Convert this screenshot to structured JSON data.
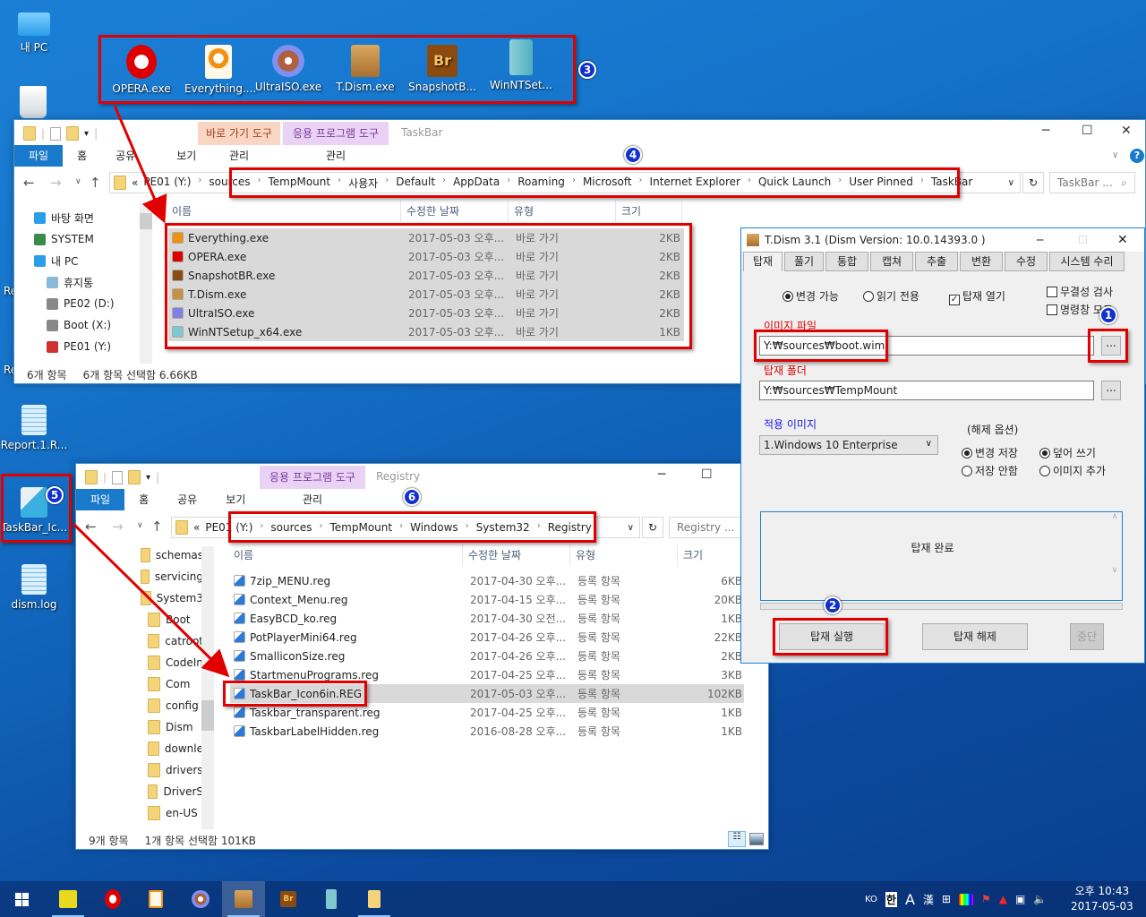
{
  "desktop": {
    "icons": [
      {
        "label": "내 PC"
      },
      {
        "label": "Report.1.R..."
      },
      {
        "label": "TaskBar_Ic..."
      },
      {
        "label": "dism.log"
      }
    ],
    "partial_labels": [
      "Re",
      "Re"
    ]
  },
  "pinned_group": {
    "items": [
      {
        "label": "OPERA.exe"
      },
      {
        "label": "Everything...."
      },
      {
        "label": "UltraISO.exe"
      },
      {
        "label": "T.Dism.exe"
      },
      {
        "label": "SnapshotB..."
      },
      {
        "label": "WinNTSet..."
      }
    ]
  },
  "badges": [
    "1",
    "2",
    "3",
    "4",
    "5",
    "6"
  ],
  "explorer_top": {
    "title": "TaskBar",
    "ctx_tools": [
      {
        "top": "바로 가기 도구",
        "bottom": "관리",
        "color": "#f8d6c3"
      },
      {
        "top": "응용 프로그램 도구",
        "bottom": "관리",
        "color": "#e9d2f4"
      }
    ],
    "ribbon_tabs": [
      "파일",
      "홈",
      "공유",
      "보기"
    ],
    "address_prefix": "«",
    "address": [
      "PE01 (Y:)",
      "sources",
      "TempMount",
      "사용자",
      "Default",
      "AppData",
      "Roaming",
      "Microsoft",
      "Internet Explorer",
      "Quick Launch",
      "User Pinned",
      "TaskBar"
    ],
    "search_placeholder": "TaskBar ...",
    "tree": [
      {
        "label": "바탕 화면"
      },
      {
        "label": "SYSTEM"
      },
      {
        "label": "내 PC"
      },
      {
        "label": "휴지통"
      },
      {
        "label": "PE02 (D:)"
      },
      {
        "label": "Boot (X:)"
      },
      {
        "label": "PE01 (Y:)"
      }
    ],
    "columns": [
      "이름",
      "수정한 날짜",
      "유형",
      "크기"
    ],
    "rows": [
      {
        "name": "Everything.exe",
        "date": "2017-05-03 오후...",
        "type": "바로 가기",
        "size": "2KB"
      },
      {
        "name": "OPERA.exe",
        "date": "2017-05-03 오후...",
        "type": "바로 가기",
        "size": "2KB"
      },
      {
        "name": "SnapshotBR.exe",
        "date": "2017-05-03 오후...",
        "type": "바로 가기",
        "size": "2KB"
      },
      {
        "name": "T.Dism.exe",
        "date": "2017-05-03 오후...",
        "type": "바로 가기",
        "size": "2KB"
      },
      {
        "name": "UltraISO.exe",
        "date": "2017-05-03 오후...",
        "type": "바로 가기",
        "size": "2KB"
      },
      {
        "name": "WinNTSetup_x64.exe",
        "date": "2017-05-03 오후...",
        "type": "바로 가기",
        "size": "1KB"
      }
    ],
    "status_count": "6개 항목",
    "status_selected": "6개 항목 선택함 6.66KB"
  },
  "explorer_bottom": {
    "title": "Registry",
    "ctx_tools": [
      {
        "top": "응용 프로그램 도구",
        "bottom": "관리",
        "color": "#e9d2f4"
      }
    ],
    "ribbon_tabs": [
      "파일",
      "홈",
      "공유",
      "보기"
    ],
    "address_prefix": "«",
    "address": [
      "PE01 (Y:)",
      "sources",
      "TempMount",
      "Windows",
      "System32",
      "Registry"
    ],
    "search_placeholder": "Registry ...",
    "tree": [
      {
        "label": "schemas"
      },
      {
        "label": "servicing"
      },
      {
        "label": "System3"
      },
      {
        "label": "Boot"
      },
      {
        "label": "catroot"
      },
      {
        "label": "CodeIn"
      },
      {
        "label": "Com"
      },
      {
        "label": "config"
      },
      {
        "label": "Dism"
      },
      {
        "label": "downle"
      },
      {
        "label": "drivers"
      },
      {
        "label": "DriverS"
      },
      {
        "label": "en-US"
      }
    ],
    "columns": [
      "이름",
      "수정한 날짜",
      "유형",
      "크기"
    ],
    "rows": [
      {
        "name": "7zip_MENU.reg",
        "date": "2017-04-30 오후...",
        "type": "등록 항목",
        "size": "6KB"
      },
      {
        "name": "Context_Menu.reg",
        "date": "2017-04-15 오후...",
        "type": "등록 항목",
        "size": "20KB"
      },
      {
        "name": "EasyBCD_ko.reg",
        "date": "2017-04-30 오전...",
        "type": "등록 항목",
        "size": "1KB"
      },
      {
        "name": "PotPlayerMini64.reg",
        "date": "2017-04-26 오후...",
        "type": "등록 항목",
        "size": "22KB"
      },
      {
        "name": "SmalliconSize.reg",
        "date": "2017-04-26 오후...",
        "type": "등록 항목",
        "size": "2KB"
      },
      {
        "name": "StartmenuPrograms.reg",
        "date": "2017-04-25 오후...",
        "type": "등록 항목",
        "size": "3KB"
      },
      {
        "name": "TaskBar_Icon6in.REG",
        "date": "2017-05-03 오후...",
        "type": "등록 항목",
        "size": "102KB",
        "selected": true
      },
      {
        "name": "Taskbar_transparent.reg",
        "date": "2017-04-25 오후...",
        "type": "등록 항목",
        "size": "1KB"
      },
      {
        "name": "TaskbarLabelHidden.reg",
        "date": "2016-08-28 오후...",
        "type": "등록 항목",
        "size": "1KB"
      }
    ],
    "status_count": "9개 항목",
    "status_selected": "1개 항목 선택함 101KB"
  },
  "tdism": {
    "title": "T.Dism 3.1 (Dism Version: 10.0.14393.0 )",
    "tabs": [
      "탑재",
      "풀기",
      "통합",
      "캡쳐",
      "추출",
      "변환",
      "수정",
      "시스템 수리"
    ],
    "mode_options": [
      {
        "label": "변경 가능",
        "checked": true
      },
      {
        "label": "읽기 전용",
        "checked": false
      }
    ],
    "open_mount": {
      "label": "탑재 열기",
      "checked": true
    },
    "integrity_check": {
      "label": "무결성 검사",
      "checked": false
    },
    "cmd_mode": {
      "label": "명령창 모드",
      "checked": false
    },
    "image_file_label": "이미지 파일",
    "image_file_value": "Y:₩sources₩boot.wim",
    "mount_folder_label": "탑재 폴더",
    "mount_folder_value": "Y:₩sources₩TempMount",
    "browse_label": "...",
    "apply_image_label": "적용 이미지",
    "apply_image_value": "1.Windows 10 Enterprise",
    "unmount_options_label": "(해제 옵션)",
    "save_options": [
      {
        "label": "변경 저장",
        "checked": true
      },
      {
        "label": "저장 안함",
        "checked": false
      }
    ],
    "write_options": [
      {
        "label": "덮어 쓰기",
        "checked": true
      },
      {
        "label": "이미지 추가",
        "checked": false
      }
    ],
    "log_text": "탑재 완료",
    "btn_mount": "탑재 실행",
    "btn_unmount": "탑재 해제",
    "btn_stop": "중단",
    "colors": {
      "label_red": "#e00000",
      "label_blue": "#1a1ae0"
    }
  },
  "taskbar": {
    "apps": [
      "start",
      "registry-editor",
      "opera",
      "everything",
      "ultraiso",
      "tdism",
      "snapshotbr",
      "winntsetup",
      "file-explorer"
    ],
    "lang": "KO",
    "ime_hangul": "한",
    "ime_a": "A",
    "ime_hanja": "漢",
    "time": "오후 10:43",
    "date": "2017-05-03"
  }
}
